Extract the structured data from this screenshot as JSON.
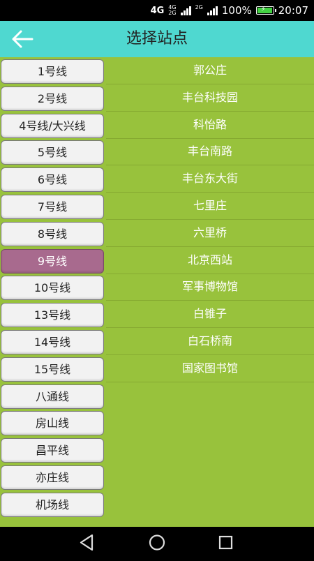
{
  "statusbar": {
    "network": "4G",
    "net_small_1": "4G",
    "net_small_2": "2G",
    "net_small_3": "2G",
    "battery_percent": "100%",
    "time": "20:07",
    "battery_level": 1.0
  },
  "header": {
    "title": "选择站点"
  },
  "lines": [
    {
      "label": "1号线"
    },
    {
      "label": "2号线"
    },
    {
      "label": "4号线/大兴线"
    },
    {
      "label": "5号线"
    },
    {
      "label": "6号线"
    },
    {
      "label": "7号线"
    },
    {
      "label": "8号线"
    },
    {
      "label": "9号线"
    },
    {
      "label": "10号线"
    },
    {
      "label": "13号线"
    },
    {
      "label": "14号线"
    },
    {
      "label": "15号线"
    },
    {
      "label": "八通线"
    },
    {
      "label": "房山线"
    },
    {
      "label": "昌平线"
    },
    {
      "label": "亦庄线"
    },
    {
      "label": "机场线"
    }
  ],
  "selected_line": "9号线",
  "stations": [
    {
      "name": "郭公庄"
    },
    {
      "name": "丰台科技园"
    },
    {
      "name": "科怡路"
    },
    {
      "name": "丰台南路"
    },
    {
      "name": "丰台东大街"
    },
    {
      "name": "七里庄"
    },
    {
      "name": "六里桥"
    },
    {
      "name": "北京西站"
    },
    {
      "name": "军事博物馆"
    },
    {
      "name": "白锥子"
    },
    {
      "name": "白石桥南"
    },
    {
      "name": "国家图书馆"
    }
  ],
  "colors": {
    "header": "#4fd8d0",
    "content": "#98c23c",
    "selected": "#a86a8e"
  },
  "icons": {
    "back": "arrow-left-icon",
    "nav_back": "triangle-back-icon",
    "nav_home": "circle-home-icon",
    "nav_recent": "square-recent-icon"
  }
}
